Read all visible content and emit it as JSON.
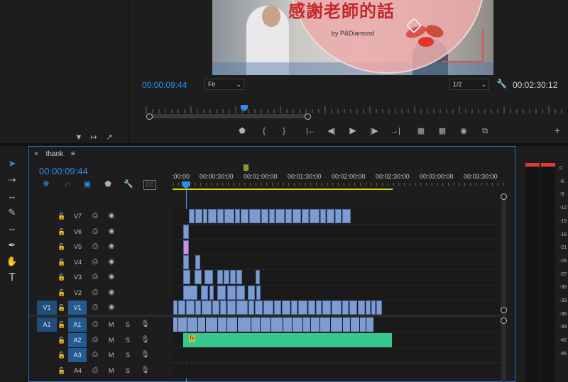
{
  "program_monitor": {
    "video_title": "感謝老師的話",
    "video_credit": "by P&Diamond",
    "current_timecode": "00:00:09:44",
    "fit_label": "Fit",
    "resolution": "1/2",
    "duration_timecode": "00:02:30:12"
  },
  "timeline": {
    "sequence_name": "thank",
    "current_timecode": "00:00:09:44",
    "ruler_labels": [
      ":00:00",
      "00:00:30:00",
      "00:01:00:00",
      "00:01:30:00",
      "00:02:00:00",
      "00:02:30:00",
      "00:03:00:00",
      "00:03:30:00"
    ],
    "video_tracks": [
      "V7",
      "V6",
      "V5",
      "V4",
      "V3",
      "V2",
      "V1"
    ],
    "audio_tracks": [
      "A1",
      "A2",
      "A3",
      "A4"
    ],
    "source_v": "V1",
    "source_a": "A1",
    "mute_label": "M",
    "solo_label": "S",
    "fx_badge": "fx"
  },
  "meter": {
    "scale": [
      "0",
      "-6",
      "-9",
      "-12",
      "-15",
      "-18",
      "-21",
      "-24",
      "-27",
      "-30",
      "-33",
      "-36",
      "-39",
      "-42",
      "-45"
    ]
  },
  "colors": {
    "accent": "#2d8ceb",
    "video_clip": "#7e9cd1",
    "audio_clip": "#36c88f",
    "work_area": "#d8d500"
  }
}
